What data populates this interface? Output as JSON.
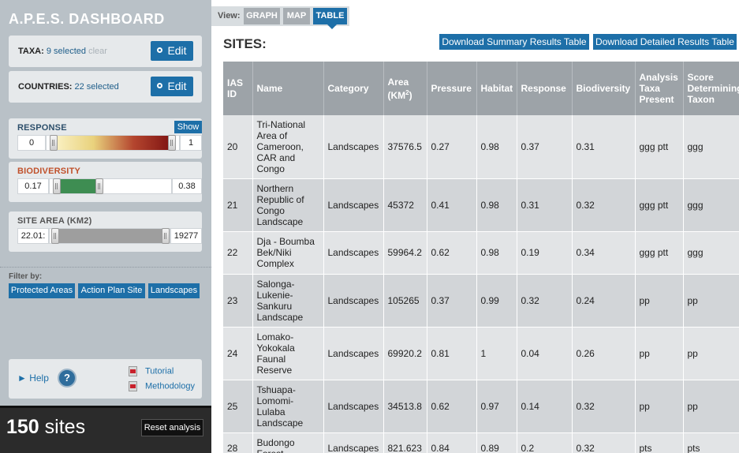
{
  "app": {
    "title": "A.P.E.S. DASHBOARD"
  },
  "taxa": {
    "label": "TAXA:",
    "count": "9 selected",
    "clear": "clear",
    "edit": "Edit"
  },
  "countries": {
    "label": "COUNTRIES:",
    "count": "22 selected",
    "edit": "Edit"
  },
  "response": {
    "title": "RESPONSE",
    "show": "Show",
    "min": "0",
    "max": "1",
    "range": [
      0,
      1
    ],
    "title_color": "#2d4f6b",
    "fill": "gradient-yellow-to-dark-red"
  },
  "biodiversity": {
    "title": "BIODIVERSITY",
    "min": "0.17",
    "max": "0.38",
    "range": [
      0.17,
      0.38
    ],
    "title_color": "#c0512b",
    "fill_color": "#3e8d52"
  },
  "site_area": {
    "title": "SITE AREA (KM2)",
    "min": "22.01:",
    "max": "19277",
    "fill_color": "#9e9e9e"
  },
  "filter": {
    "label": "Filter by:",
    "buttons": [
      "Protected Areas",
      "Action Plan Site",
      "Landscapes"
    ]
  },
  "help": {
    "label": "► Help",
    "icon": "?",
    "tutorial": "Tutorial",
    "methodology": "Methodology"
  },
  "footer": {
    "count": "150",
    "suffix": " sites",
    "reset": "Reset analysis"
  },
  "view": {
    "label": "View:",
    "tabs": [
      {
        "label": "GRAPH",
        "active": false
      },
      {
        "label": "MAP",
        "active": false
      },
      {
        "label": "TABLE",
        "active": true
      }
    ]
  },
  "sites": {
    "title": "SITES:",
    "download_summary": "Download Summary Results Table",
    "download_detailed": "Download Detailed Results Table"
  },
  "table": {
    "headers": [
      "IAS ID",
      "Name",
      "Category",
      "Area (KM2)",
      "Pressure",
      "Habitat",
      "Response",
      "Biodiversity",
      "Analysis Taxa Present",
      "Score Determining Taxon"
    ],
    "rows": [
      [
        "20",
        "Tri-National Area of Cameroon, CAR and Congo",
        "Landscapes",
        "37576.5",
        "0.27",
        "0.98",
        "0.37",
        "0.31",
        "ggg ptt",
        "ggg"
      ],
      [
        "21",
        "Northern Republic of Congo Landscape",
        "Landscapes",
        "45372",
        "0.41",
        "0.98",
        "0.31",
        "0.32",
        "ggg ptt",
        "ggg"
      ],
      [
        "22",
        "Dja - Boumba Bek/Niki Complex",
        "Landscapes",
        "59964.2",
        "0.62",
        "0.98",
        "0.19",
        "0.34",
        "ggg ptt",
        "ggg"
      ],
      [
        "23",
        "Salonga-Lukenie-Sankuru Landscape",
        "Landscapes",
        "105265",
        "0.37",
        "0.99",
        "0.32",
        "0.24",
        "pp",
        "pp"
      ],
      [
        "24",
        "Lomako-Yokokala Faunal Reserve",
        "Landscapes",
        "69920.2",
        "0.81",
        "1",
        "0.04",
        "0.26",
        "pp",
        "pp"
      ],
      [
        "25",
        "Tshuapa-Lomomi-Lulaba Landscape",
        "Landscapes",
        "34513.8",
        "0.62",
        "0.97",
        "0.14",
        "0.32",
        "pp",
        "pp"
      ],
      [
        "28",
        "Budongo Forest",
        "Landscapes",
        "821.623",
        "0.84",
        "0.89",
        "0.2",
        "0.32",
        "pts",
        "pts"
      ]
    ]
  }
}
